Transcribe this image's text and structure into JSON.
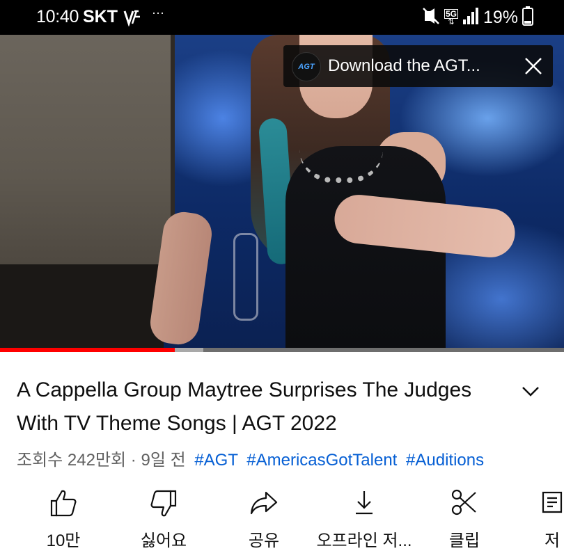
{
  "status_bar": {
    "time": "10:40",
    "carrier": "SKT",
    "dots": "···",
    "network": "5G",
    "battery": "19%"
  },
  "video": {
    "banner_text": "Download the AGT...",
    "banner_logo": "AGT",
    "progress": 0.31,
    "buffered": 0.36,
    "colors": {
      "progress": "#ff0000",
      "buffer": "#a9a9a9",
      "track": "#6e6e6e"
    }
  },
  "title": "A Cappella Group Maytree Surprises The Judges With TV Theme Songs | AGT 2022",
  "meta": {
    "views": "조회수 242만회",
    "separator": "·",
    "age": "9일 전",
    "hashtags": [
      "#AGT",
      "#AmericasGotTalent",
      "#Auditions"
    ],
    "link_color": "#065fd4"
  },
  "actions": [
    {
      "icon": "thumbs-up-icon",
      "label": "10만"
    },
    {
      "icon": "thumbs-down-icon",
      "label": "싫어요"
    },
    {
      "icon": "share-icon",
      "label": "공유"
    },
    {
      "icon": "download-icon",
      "label": "오프라인 저..."
    },
    {
      "icon": "scissors-icon",
      "label": "클립"
    },
    {
      "icon": "save-icon",
      "label": "저"
    }
  ]
}
